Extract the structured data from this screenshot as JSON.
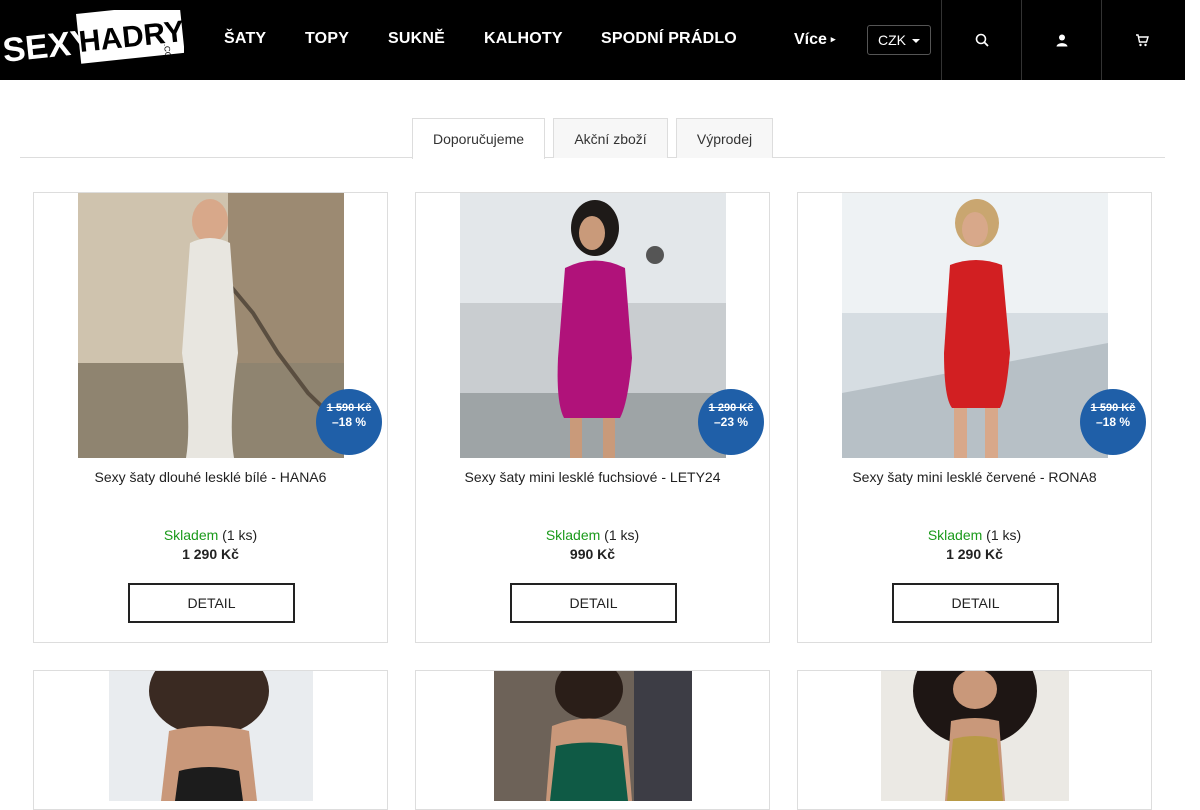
{
  "logo": {
    "text": "SEXY HADRY",
    "suffix": ".COM"
  },
  "nav": {
    "items": [
      {
        "label": "ŠATY"
      },
      {
        "label": "TOPY"
      },
      {
        "label": "SUKNĚ"
      },
      {
        "label": "KALHOTY"
      },
      {
        "label": "SPODNÍ PRÁDLO"
      }
    ],
    "more": "Více",
    "more_caret": "▸",
    "currency": "CZK",
    "icons": [
      "search-icon",
      "user-icon",
      "cart-icon"
    ]
  },
  "tabs": [
    {
      "label": "Doporučujeme"
    },
    {
      "label": "Akční zboží"
    },
    {
      "label": "Výprodej"
    }
  ],
  "products": [
    {
      "name": "Sexy šaty dlouhé lesklé bílé - HANA6",
      "old_price": "1 590 Kč",
      "discount": "–18 %",
      "stock": "Skladem",
      "qty": "(1 ks)",
      "price": "1 290 Kč",
      "button": "DETAIL",
      "color": "#e8e6e0"
    },
    {
      "name": "Sexy šaty mini lesklé fuchsiové - LETY24",
      "old_price": "1 290 Kč",
      "discount": "–23 %",
      "stock": "Skladem",
      "qty": "(1 ks)",
      "price": "990 Kč",
      "button": "DETAIL",
      "color": "#b0127a"
    },
    {
      "name": "Sexy šaty mini lesklé červené - RONA8",
      "old_price": "1 590 Kč",
      "discount": "–18 %",
      "stock": "Skladem",
      "qty": "(1 ks)",
      "price": "1 290 Kč",
      "button": "DETAIL",
      "color": "#d21f22"
    },
    {
      "name": "",
      "color": "#1c1c1c"
    },
    {
      "name": "",
      "color": "#0f5a45"
    },
    {
      "name": "",
      "color": "#b89a45"
    }
  ]
}
